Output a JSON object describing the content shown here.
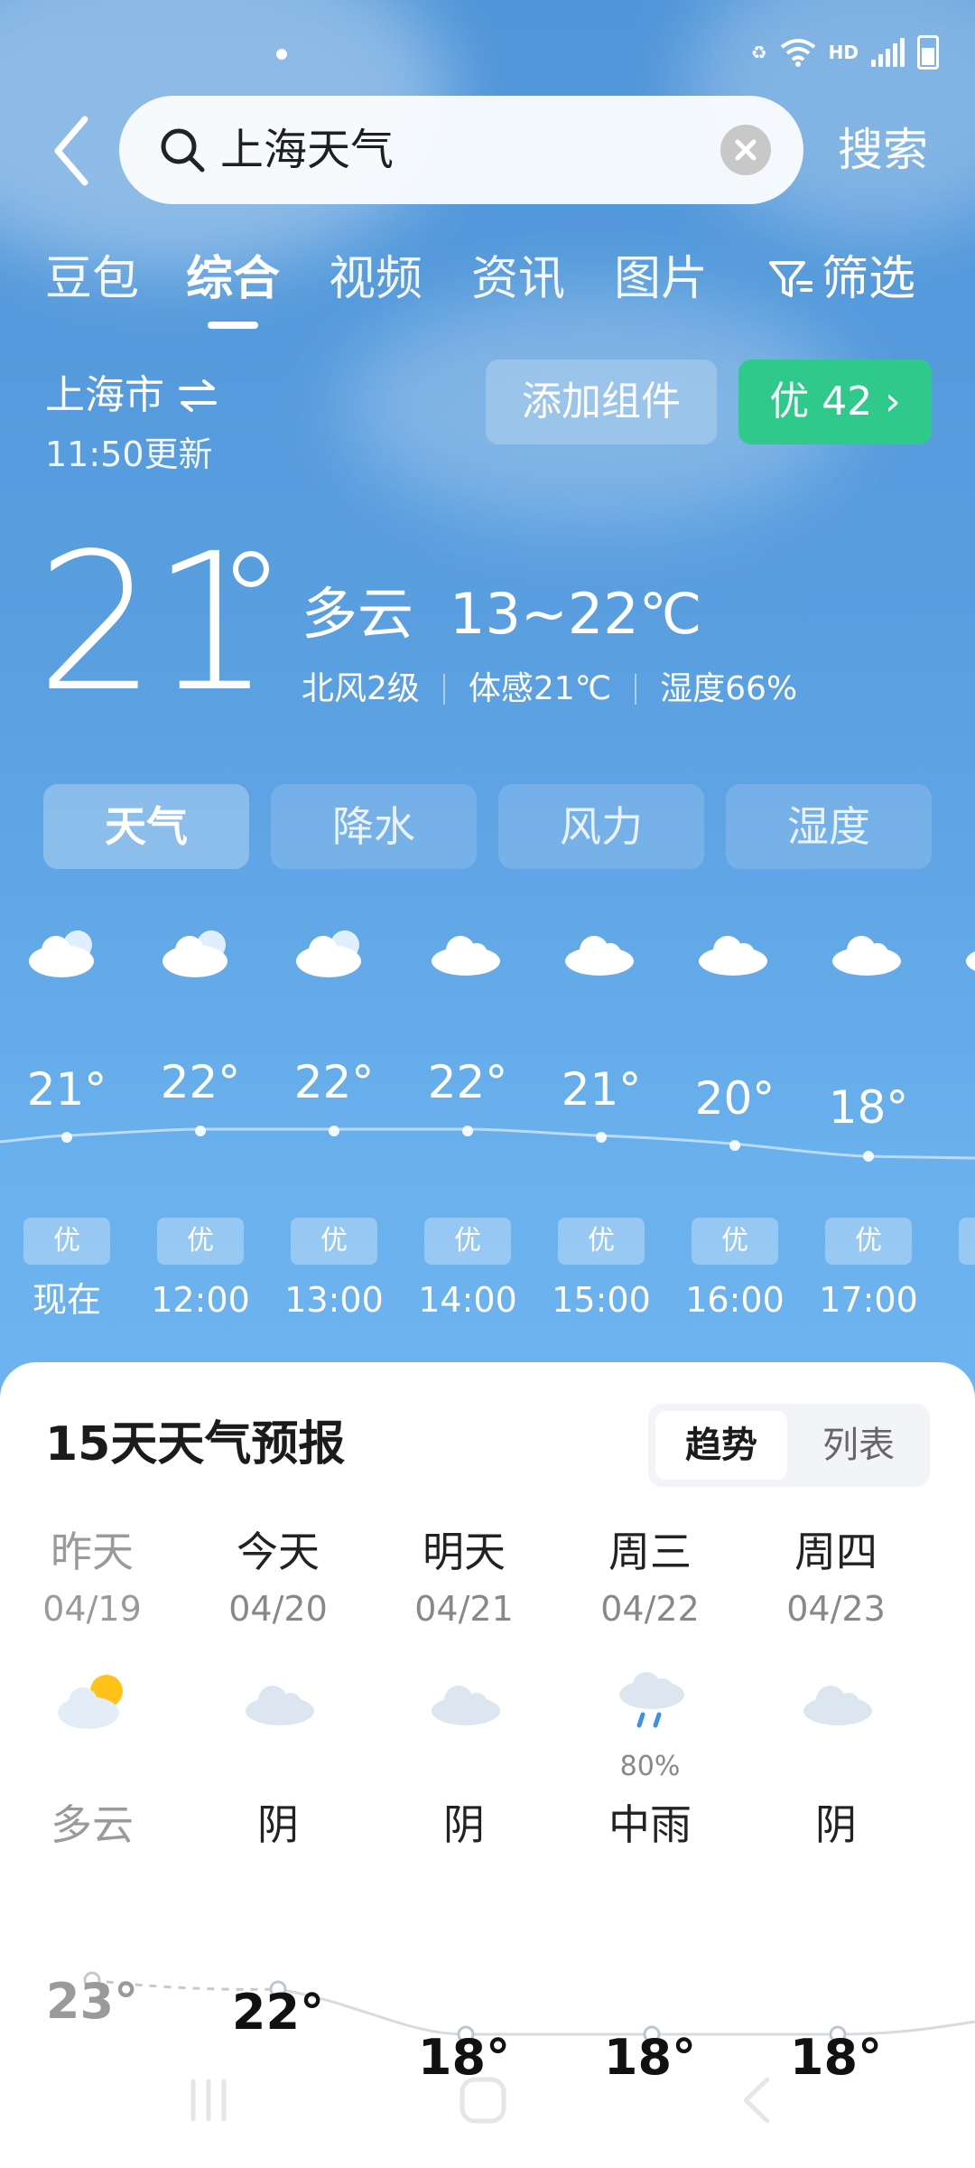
{
  "search": {
    "query": "上海天气",
    "button_label": "搜索"
  },
  "tabs": [
    {
      "label": "豆包"
    },
    {
      "label": "综合",
      "active": true
    },
    {
      "label": "视频"
    },
    {
      "label": "资讯"
    },
    {
      "label": "图片"
    }
  ],
  "filter_label": "筛选",
  "location": {
    "city": "上海市",
    "updated": "11:50更新"
  },
  "add_widget_label": "添加组件",
  "aqi_badge": "优 42 ›",
  "current": {
    "temp": "21",
    "condition": "多云",
    "range": "13~22℃",
    "wind": "北风2级",
    "feels_like": "体感21℃",
    "humidity": "湿度66%"
  },
  "metric_tabs": [
    {
      "label": "天气",
      "active": true
    },
    {
      "label": "降水"
    },
    {
      "label": "风力"
    },
    {
      "label": "湿度"
    }
  ],
  "hourly": [
    {
      "time": "现在",
      "temp": "21°",
      "aqi": "优",
      "icon": "partly-cloudy-icon"
    },
    {
      "time": "12:00",
      "temp": "22°",
      "aqi": "优",
      "icon": "partly-cloudy-icon"
    },
    {
      "time": "13:00",
      "temp": "22°",
      "aqi": "优",
      "icon": "partly-cloudy-icon"
    },
    {
      "time": "14:00",
      "temp": "22°",
      "aqi": "优",
      "icon": "cloud-icon"
    },
    {
      "time": "15:00",
      "temp": "21°",
      "aqi": "优",
      "icon": "cloud-icon"
    },
    {
      "time": "16:00",
      "temp": "20°",
      "aqi": "优",
      "icon": "cloud-icon"
    },
    {
      "time": "17:00",
      "temp": "18°",
      "aqi": "优",
      "icon": "cloud-icon"
    }
  ],
  "forecast": {
    "title": "15天天气预报",
    "view_trend": "趋势",
    "view_list": "列表",
    "days": [
      {
        "name": "昨天",
        "date": "04/19",
        "condition": "多云",
        "high": "23°",
        "icon": "partly-sunny-icon",
        "past": true
      },
      {
        "name": "今天",
        "date": "04/20",
        "condition": "阴",
        "high": "22°",
        "icon": "overcast-icon"
      },
      {
        "name": "明天",
        "date": "04/21",
        "condition": "阴",
        "high": "18°",
        "icon": "overcast-icon"
      },
      {
        "name": "周三",
        "date": "04/22",
        "condition": "中雨",
        "high": "18°",
        "icon": "rain-icon",
        "pop": "80%"
      },
      {
        "name": "周四",
        "date": "04/23",
        "condition": "阴",
        "high": "18°",
        "icon": "overcast-icon"
      }
    ]
  },
  "colors": {
    "accent_green": "#2fc98b",
    "sky": "#5a9fe0"
  }
}
